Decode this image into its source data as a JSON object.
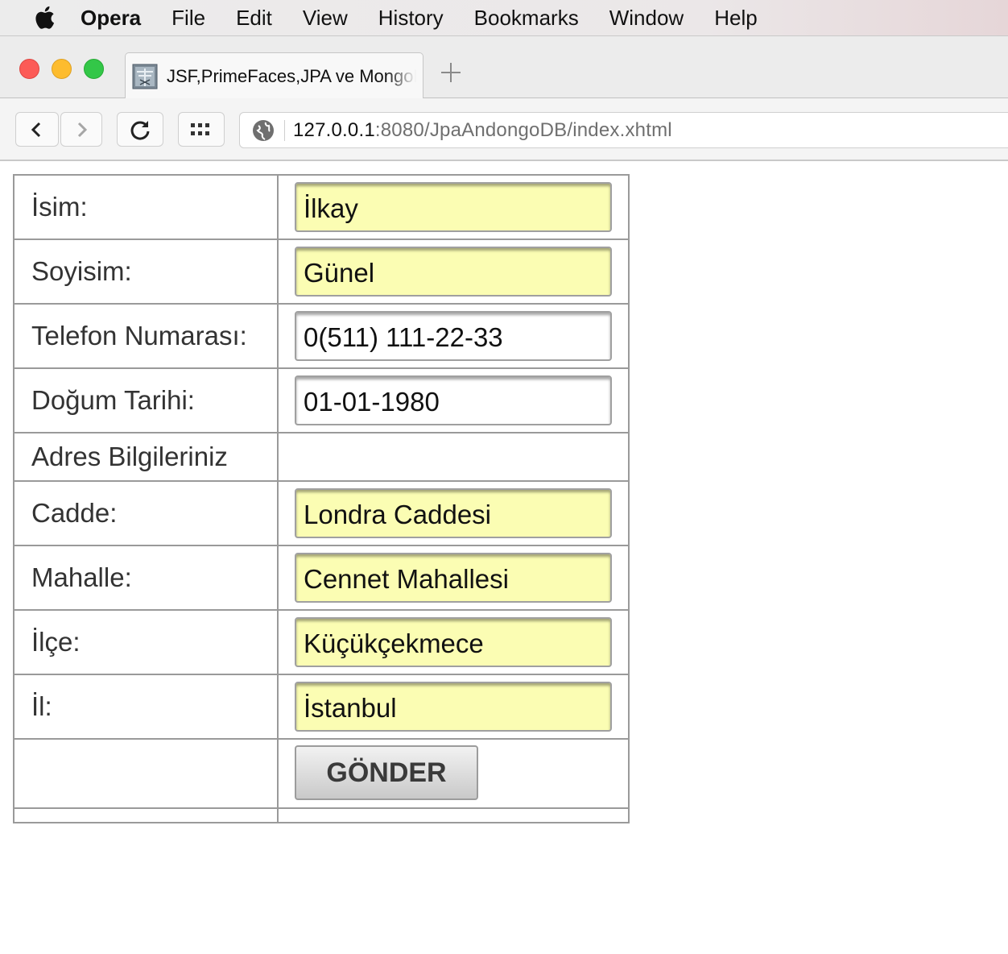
{
  "menubar": {
    "apple_icon": "apple-logo-icon",
    "app_name": "Opera",
    "items": [
      "File",
      "Edit",
      "View",
      "History",
      "Bookmarks",
      "Window",
      "Help"
    ]
  },
  "tab": {
    "title": "JSF,PrimeFaces,JPA ve MongoDB",
    "favicon": "page-favicon-icon"
  },
  "toolbar": {
    "url_host": "127.0.0.1",
    "url_rest": ":8080/JpaAndongoDB/index.xhtml"
  },
  "form": {
    "isim_label": "İsim:",
    "isim_value": "İlkay",
    "soyisim_label": "Soyisim:",
    "soyisim_value": "Günel",
    "telefon_label": "Telefon Numarası:",
    "telefon_value": "0(511) 111-22-33",
    "dogum_label": "Doğum Tarihi:",
    "dogum_value": "01-01-1980",
    "adres_heading": "Adres Bilgileriniz",
    "cadde_label": "Cadde:",
    "cadde_value": "Londra Caddesi",
    "mahalle_label": "Mahalle:",
    "mahalle_value": "Cennet Mahallesi",
    "ilce_label": "İlçe:",
    "ilce_value": "Küçükçekmece",
    "il_label": "İl:",
    "il_value": "İstanbul",
    "submit_label": "GÖNDER"
  },
  "colors": {
    "required_field_bg": "#fbfdb3",
    "close_button": "#fc5b57",
    "minimize_button": "#fdbc2e",
    "zoom_button": "#33c748"
  }
}
